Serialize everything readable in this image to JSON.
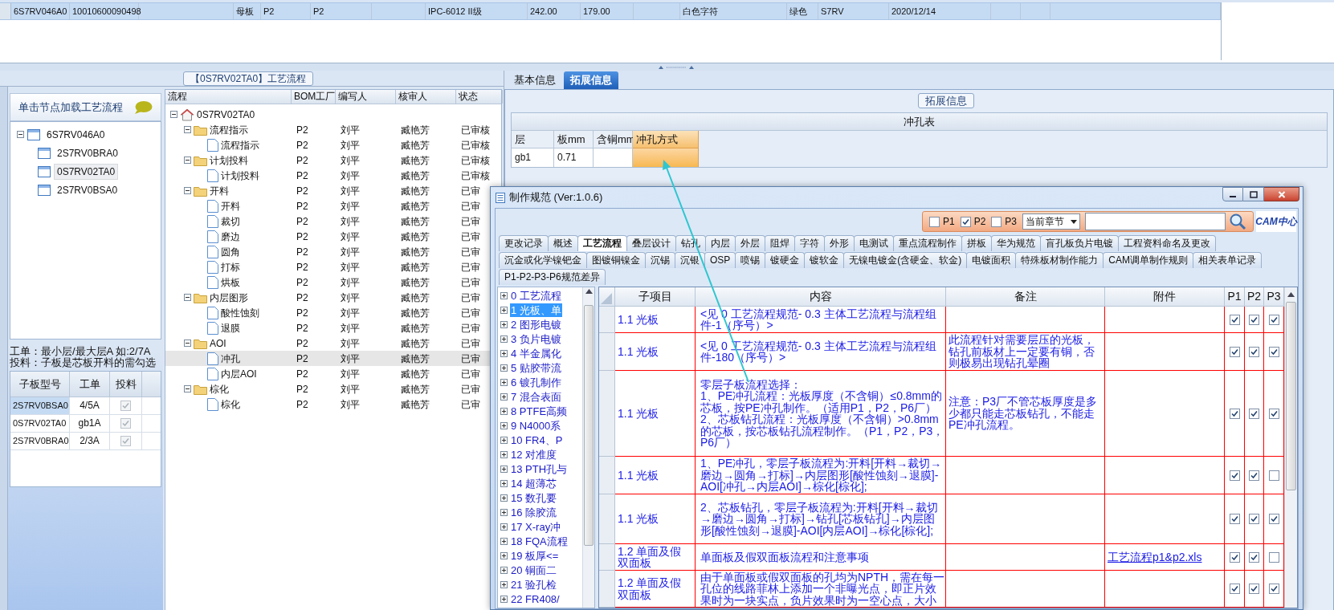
{
  "top_grid": {
    "row": {
      "selected": true,
      "cells": [
        "6S7RV046A0",
        "10010600090498",
        "母板",
        "P2",
        "P2",
        "IPC-6012 II级",
        "242.00",
        "179.00",
        "白色字符",
        "绿色",
        "S7RV",
        "2020/12/14"
      ]
    }
  },
  "process_panel": {
    "title": "【0S7RV02TA0】工艺流程",
    "hint": "单击节点加载工艺流程",
    "tree": [
      {
        "label": "6S7RV046A0",
        "expanded": true,
        "selected": false,
        "children": [
          {
            "label": "2S7RV0BRA0",
            "selected": false
          },
          {
            "label": "0S7RV02TA0",
            "selected": true
          },
          {
            "label": "2S7RV0BSA0",
            "selected": false
          }
        ]
      }
    ],
    "notes": [
      "工单：最小层/最大层A 如:2/7A",
      "投料：子板是芯板开料的需勾选"
    ],
    "sub_boards": {
      "columns": [
        "子板型号",
        "工单",
        "投料"
      ],
      "rows": [
        {
          "model": "2S7RV0BSA0",
          "work_order": "4/5A",
          "feed": true,
          "selected": true
        },
        {
          "model": "0S7RV02TA0",
          "work_order": "gb1A",
          "feed": true,
          "selected": false
        },
        {
          "model": "2S7RV0BRA0",
          "work_order": "2/3A",
          "feed": true,
          "selected": false
        }
      ]
    }
  },
  "flow_grid": {
    "columns": [
      "流程",
      "BOM工厂",
      "编写人",
      "核审人",
      "状态"
    ],
    "tree": [
      {
        "label": "0S7RV02TA0",
        "kind": "root",
        "expanded": true,
        "selected": false,
        "children": [
          {
            "label": "流程指示",
            "kind": "folder",
            "expanded": true,
            "selected": false,
            "factory": "P2",
            "writer": "刘平",
            "reviewer": "臧艳芳",
            "status": "已审核",
            "children": [
              {
                "label": "流程指示",
                "kind": "file",
                "selected": false,
                "factory": "P2",
                "writer": "刘平",
                "reviewer": "臧艳芳",
                "status": "已审核"
              }
            ]
          },
          {
            "label": "计划投料",
            "kind": "folder",
            "expanded": true,
            "selected": false,
            "factory": "P2",
            "writer": "刘平",
            "reviewer": "臧艳芳",
            "status": "已审核",
            "children": [
              {
                "label": "计划投料",
                "kind": "file",
                "selected": false,
                "factory": "P2",
                "writer": "刘平",
                "reviewer": "臧艳芳",
                "status": "已审核"
              }
            ]
          },
          {
            "label": "开料",
            "kind": "folder",
            "expanded": true,
            "selected": false,
            "factory": "P2",
            "writer": "刘平",
            "reviewer": "臧艳芳",
            "status": "已审",
            "children": [
              {
                "label": "开料",
                "kind": "file",
                "selected": false,
                "factory": "P2",
                "writer": "刘平",
                "reviewer": "臧艳芳",
                "status": "已审"
              },
              {
                "label": "裁切",
                "kind": "file",
                "selected": false,
                "factory": "P2",
                "writer": "刘平",
                "reviewer": "臧艳芳",
                "status": "已审"
              },
              {
                "label": "磨边",
                "kind": "file",
                "selected": false,
                "factory": "P2",
                "writer": "刘平",
                "reviewer": "臧艳芳",
                "status": "已审"
              },
              {
                "label": "圆角",
                "kind": "file",
                "selected": false,
                "factory": "P2",
                "writer": "刘平",
                "reviewer": "臧艳芳",
                "status": "已审"
              },
              {
                "label": "打标",
                "kind": "file",
                "selected": false,
                "factory": "P2",
                "writer": "刘平",
                "reviewer": "臧艳芳",
                "status": "已审"
              },
              {
                "label": "烘板",
                "kind": "file",
                "selected": false,
                "factory": "P2",
                "writer": "刘平",
                "reviewer": "臧艳芳",
                "status": "已审"
              }
            ]
          },
          {
            "label": "内层图形",
            "kind": "folder",
            "expanded": true,
            "selected": false,
            "factory": "P2",
            "writer": "刘平",
            "reviewer": "臧艳芳",
            "status": "已审",
            "children": [
              {
                "label": "酸性蚀刻",
                "kind": "file",
                "selected": false,
                "factory": "P2",
                "writer": "刘平",
                "reviewer": "臧艳芳",
                "status": "已审"
              },
              {
                "label": "退膜",
                "kind": "file",
                "selected": false,
                "factory": "P2",
                "writer": "刘平",
                "reviewer": "臧艳芳",
                "status": "已审"
              }
            ]
          },
          {
            "label": "AOI",
            "kind": "folder",
            "expanded": true,
            "selected": false,
            "factory": "P2",
            "writer": "刘平",
            "reviewer": "臧艳芳",
            "status": "已审",
            "children": [
              {
                "label": "冲孔",
                "kind": "file",
                "selected": true,
                "factory": "P2",
                "writer": "刘平",
                "reviewer": "臧艳芳",
                "status": "已审"
              },
              {
                "label": "内层AOI",
                "kind": "file",
                "selected": false,
                "factory": "P2",
                "writer": "刘平",
                "reviewer": "臧艳芳",
                "status": "已审"
              }
            ]
          },
          {
            "label": "棕化",
            "kind": "folder",
            "expanded": true,
            "selected": false,
            "factory": "P2",
            "writer": "刘平",
            "reviewer": "臧艳芳",
            "status": "已审",
            "children": [
              {
                "label": "棕化",
                "kind": "file",
                "selected": false,
                "factory": "P2",
                "writer": "刘平",
                "reviewer": "臧艳芳",
                "status": "已审"
              }
            ]
          }
        ]
      }
    ]
  },
  "detail_tabs": [
    {
      "label": "基本信息",
      "selected": false
    },
    {
      "label": "拓展信息",
      "selected": true
    }
  ],
  "extended_group": {
    "title": "拓展信息",
    "table": {
      "title": "冲孔表",
      "columns": [
        {
          "label": "层",
          "selected": false
        },
        {
          "label": "板mm",
          "selected": false
        },
        {
          "label": "含铜mm",
          "selected": false
        },
        {
          "label": "冲孔方式",
          "selected": true
        }
      ],
      "rows": [
        {
          "layer": "gb1",
          "board": "0.71"
        }
      ]
    }
  },
  "spec_window": {
    "title": "制作规范 (Ver:1.0.6)",
    "filters": [
      {
        "label": "P1",
        "checked": false
      },
      {
        "label": "P2",
        "checked": true
      },
      {
        "label": "P3",
        "checked": false
      }
    ],
    "scope": "当前章节",
    "logo": "CAM中心",
    "tab_rows": [
      [
        {
          "label": "更改记录",
          "selected": false
        },
        {
          "label": "概述",
          "selected": false
        },
        {
          "label": "工艺流程",
          "selected": true
        },
        {
          "label": "叠层设计",
          "selected": false
        },
        {
          "label": "钻孔",
          "selected": false
        },
        {
          "label": "内层",
          "selected": false
        },
        {
          "label": "外层",
          "selected": false
        },
        {
          "label": "阻焊",
          "selected": false
        },
        {
          "label": "字符",
          "selected": false
        },
        {
          "label": "外形",
          "selected": false
        },
        {
          "label": "电测试",
          "selected": false
        },
        {
          "label": "重点流程制作",
          "selected": false
        },
        {
          "label": "拼板",
          "selected": false
        },
        {
          "label": "华为规范",
          "selected": false
        },
        {
          "label": "盲孔板负片电镀",
          "selected": false
        },
        {
          "label": "工程资料命名及更改",
          "selected": false
        }
      ],
      [
        {
          "label": "沉金或化学镍钯金",
          "selected": false
        },
        {
          "label": "图镀铜镍金",
          "selected": false
        },
        {
          "label": "沉锡",
          "selected": false
        },
        {
          "label": "沉银",
          "selected": false
        },
        {
          "label": "OSP",
          "selected": false
        },
        {
          "label": "喷锡",
          "selected": false
        },
        {
          "label": "镀硬金",
          "selected": false
        },
        {
          "label": "镀软金",
          "selected": false
        },
        {
          "label": "无镍电镀金(含硬金、软金)",
          "selected": false
        },
        {
          "label": "电镀面积",
          "selected": false
        },
        {
          "label": "特殊板材制作能力",
          "selected": false
        },
        {
          "label": "CAM调单制作规则",
          "selected": false
        },
        {
          "label": "相关表单记录",
          "selected": false
        }
      ],
      [
        {
          "label": "P1-P2-P3-P6规范差异",
          "selected": false
        }
      ]
    ],
    "chapters": [
      {
        "label": "0 工艺流程",
        "expanded": false,
        "selected": false
      },
      {
        "label": "1 光板、单",
        "expanded": false,
        "selected": true
      },
      {
        "label": "2 图形电镀",
        "expanded": false,
        "selected": false
      },
      {
        "label": "3 负片电镀",
        "expanded": false,
        "selected": false
      },
      {
        "label": "4 半金属化",
        "expanded": false,
        "selected": false
      },
      {
        "label": "5 贴胶带流",
        "expanded": false,
        "selected": false
      },
      {
        "label": "6 镀孔制作",
        "expanded": false,
        "selected": false
      },
      {
        "label": "7 混合表面",
        "expanded": false,
        "selected": false
      },
      {
        "label": "8 PTFE高频",
        "expanded": false,
        "selected": false
      },
      {
        "label": "9 N4000系",
        "expanded": false,
        "selected": false
      },
      {
        "label": "10 FR4、P",
        "expanded": false,
        "selected": false
      },
      {
        "label": "12 对准度",
        "expanded": false,
        "selected": false
      },
      {
        "label": "13 PTH孔与",
        "expanded": false,
        "selected": false
      },
      {
        "label": "14 超薄芯",
        "expanded": false,
        "selected": false
      },
      {
        "label": "15 数孔要",
        "expanded": false,
        "selected": false
      },
      {
        "label": "16 除胶流",
        "expanded": false,
        "selected": false
      },
      {
        "label": "17 X-ray冲",
        "expanded": false,
        "selected": false
      },
      {
        "label": "18 FQA流程",
        "expanded": false,
        "selected": false
      },
      {
        "label": "19 板厚<=",
        "expanded": false,
        "selected": false
      },
      {
        "label": "20 铜面二",
        "expanded": false,
        "selected": false
      },
      {
        "label": "21 验孔检",
        "expanded": false,
        "selected": false
      },
      {
        "label": "22 FR408/",
        "expanded": false,
        "selected": false
      }
    ],
    "spec_table": {
      "columns": [
        "子项目",
        "内容",
        "备注",
        "附件",
        "P1",
        "P2",
        "P3"
      ],
      "rows": [
        {
          "item": "1.1 光板",
          "content": "<见 0 工艺流程规范- 0.3 主体工艺流程与流程组件-1（序号）>",
          "p1": true,
          "p2": true,
          "p3": true
        },
        {
          "item": "1.1 光板",
          "content": "<见 0 工艺流程规范- 0.3 主体工艺流程与流程组件-180（序号）>",
          "note": "此流程针对需要层压的光板，钻孔前板材上一定要有铜，否则极易出现钻孔晕圈",
          "p1": true,
          "p2": true,
          "p3": true
        },
        {
          "item": "1.1 光板",
          "content": "零层子板流程选择：\n1、PE冲孔流程：光板厚度（不含铜）≤0.8mm的芯板，按PE冲孔制作。（适用P1，P2，P6厂）\n2、芯板钻孔流程：光板厚度（不含铜）>0.8mm的芯板，按芯板钻孔流程制作。（P1，P2，P3，P6厂）",
          "note": "注意：P3厂不管芯板厚度是多少都只能走芯板钻孔，不能走PE冲孔流程。",
          "p1": true,
          "p2": true,
          "p3": true
        },
        {
          "item": "1.1 光板",
          "content": "1、PE冲孔，零层子板流程为:开料[开料→裁切→磨边→圆角→打标]→内层图形[酸性蚀刻→退膜]-AOI[冲孔→内层AOI]→棕化[棕化];",
          "p1": true,
          "p2": true,
          "p3": false
        },
        {
          "item": "1.1 光板",
          "content": "2、芯板钻孔，零层子板流程为:开料[开料→裁切→磨边→圆角→打标]→钻孔[芯板钻孔]→内层图形[酸性蚀刻→退膜]-AOI[内层AOI]→棕化[棕化];",
          "p1": true,
          "p2": true,
          "p3": true
        },
        {
          "item": "1.2 单面及假双面板",
          "content": "单面板及假双面板流程和注意事项",
          "attachment": "工艺流程p1&p2.xls",
          "p1": true,
          "p2": true,
          "p3": false
        },
        {
          "item": "1.2 单面及假双面板",
          "content": "由于单面板或假双面板的孔均为NPTH，需在每一孔位的线路菲林上添加一个非曝光点，即正片效果时为一块实点，负片效果时为一空心点，大小",
          "p1": true,
          "p2": true,
          "p3": true
        }
      ]
    }
  }
}
